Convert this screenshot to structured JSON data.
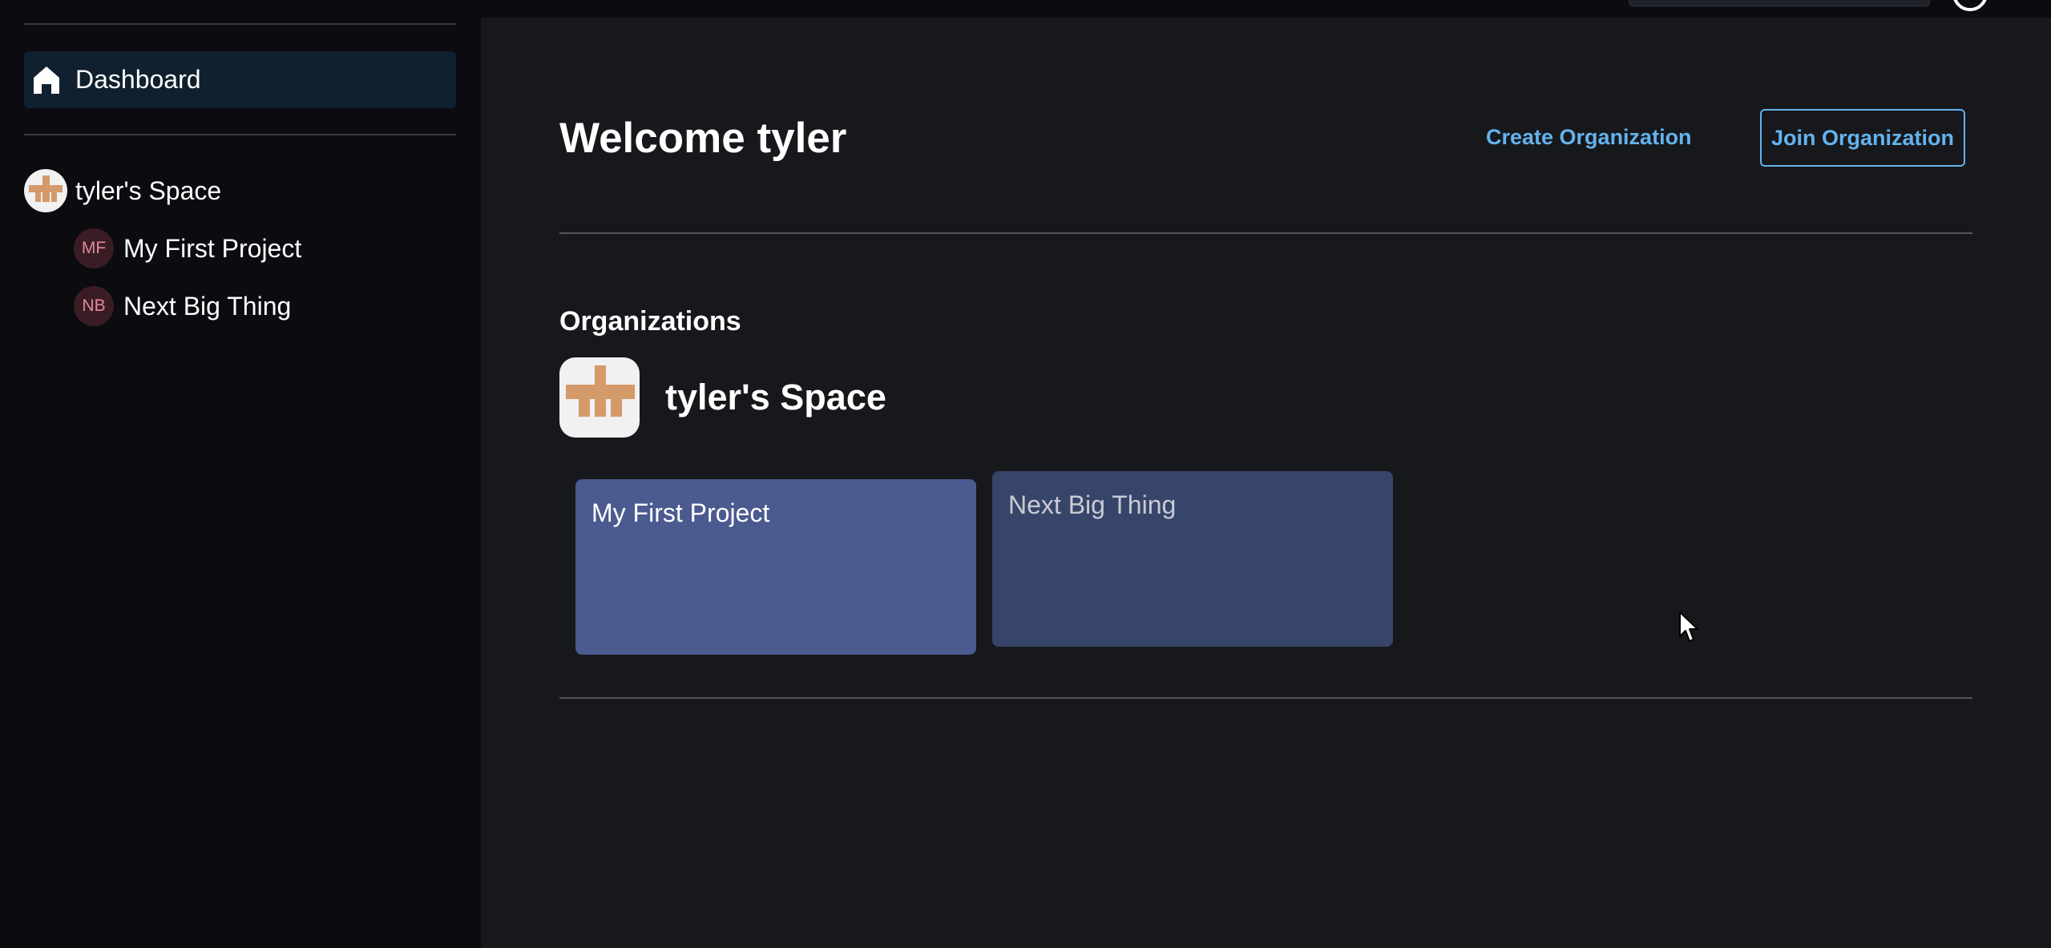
{
  "sidebar": {
    "dashboard_label": "Dashboard",
    "space": {
      "label": "tyler's Space",
      "projects": [
        {
          "initials": "MF",
          "label": "My First Project"
        },
        {
          "initials": "NB",
          "label": "Next Big Thing"
        }
      ]
    }
  },
  "main": {
    "welcome": "Welcome tyler",
    "create_org_label": "Create Organization",
    "join_org_label": "Join Organization",
    "organizations_title": "Organizations",
    "org": {
      "name": "tyler's Space",
      "projects": [
        {
          "title": "My First Project"
        },
        {
          "title": "Next Big Thing"
        }
      ]
    }
  },
  "colors": {
    "accent": "#63b3ed",
    "sidebar_bg": "#0b0b10",
    "main_bg": "#17181c",
    "card_primary": "#4b5a8f",
    "card_secondary": "#38456a",
    "avatar_cross": "#d49a6a"
  },
  "icons": [
    "home-icon",
    "cross-avatar-icon",
    "mouse-cursor-icon"
  ]
}
